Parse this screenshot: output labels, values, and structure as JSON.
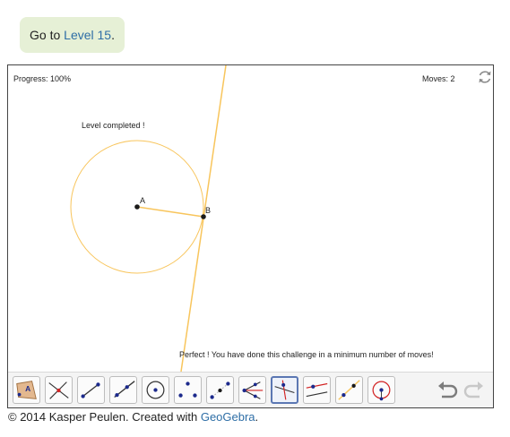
{
  "goto": {
    "prefix": "Go to ",
    "link": "Level 15",
    "suffix": "."
  },
  "applet": {
    "progress": "Progress: 100%",
    "moves": "Moves: 2",
    "level_completed": "Level completed !",
    "perfect_message": "Perfect ! You have done this challenge in a minimum number of moves!",
    "points": {
      "a": "A",
      "b": "B"
    },
    "refresh_icon": "refresh-icon"
  },
  "toolbar": {
    "selected_index": 9,
    "tools": [
      "polygon-tool-icon",
      "intersect-tool-icon",
      "segment-tool-icon",
      "ray-tool-icon",
      "circle-tool-icon",
      "point-tool-icon",
      "midpoint-tool-icon",
      "angle-bisector-tool-icon",
      "perpendicular-line-tool-icon",
      "parallel-line-tool-icon",
      "line-tool-icon",
      "compass-tool-icon"
    ],
    "undo_icon": "undo-icon",
    "redo_icon": "redo-icon"
  },
  "colors": {
    "construction": "#f8c55c",
    "point": "#1a1a1a",
    "tool_accent": "#1c2a8c",
    "tool_red": "#d22222",
    "link": "#2e6ea6"
  },
  "footer": {
    "prefix": "© 2014 Kasper Peulen. Created with ",
    "link": "GeoGebra",
    "suffix": "."
  }
}
